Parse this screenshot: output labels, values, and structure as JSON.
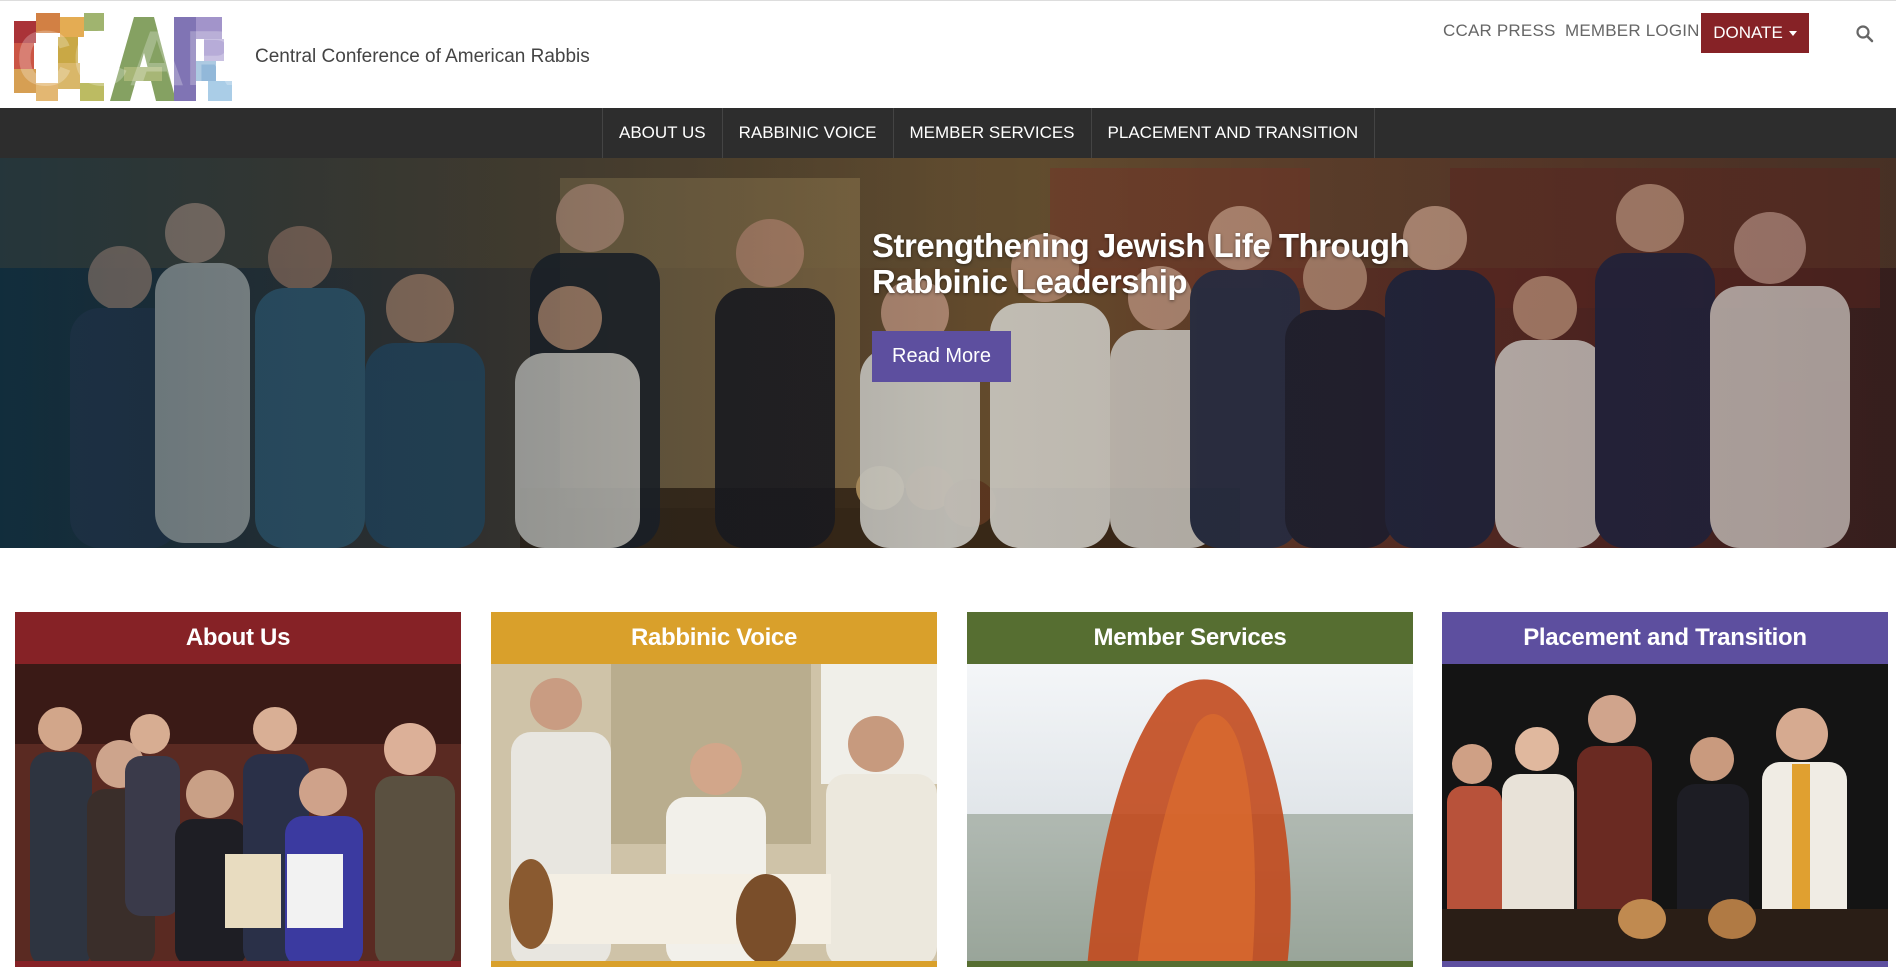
{
  "header": {
    "logo_text": "CCAR",
    "org_name": "Central Conference of American Rabbis",
    "links": {
      "press": "CCAR PRESS",
      "login": "MEMBER LOGIN"
    },
    "donate_label": "DONATE",
    "search_icon": "search-icon"
  },
  "nav": {
    "items": [
      {
        "label": "ABOUT US"
      },
      {
        "label": "RABBINIC VOICE"
      },
      {
        "label": "MEMBER SERVICES"
      },
      {
        "label": "PLACEMENT AND TRANSITION"
      }
    ]
  },
  "hero": {
    "title": "Strengthening Jewish Life Through Rabbinic Leadership",
    "button_label": "Read More"
  },
  "cards": [
    {
      "title": "About Us",
      "color": "#862226"
    },
    {
      "title": "Rabbinic Voice",
      "color": "#d9a02b"
    },
    {
      "title": "Member Services",
      "color": "#566e31"
    },
    {
      "title": "Placement and Transition",
      "color": "#5d4f9f"
    }
  ],
  "colors": {
    "nav_bg": "#2d2d2d",
    "donate": "#862226",
    "read_more": "#5d4f9f"
  }
}
